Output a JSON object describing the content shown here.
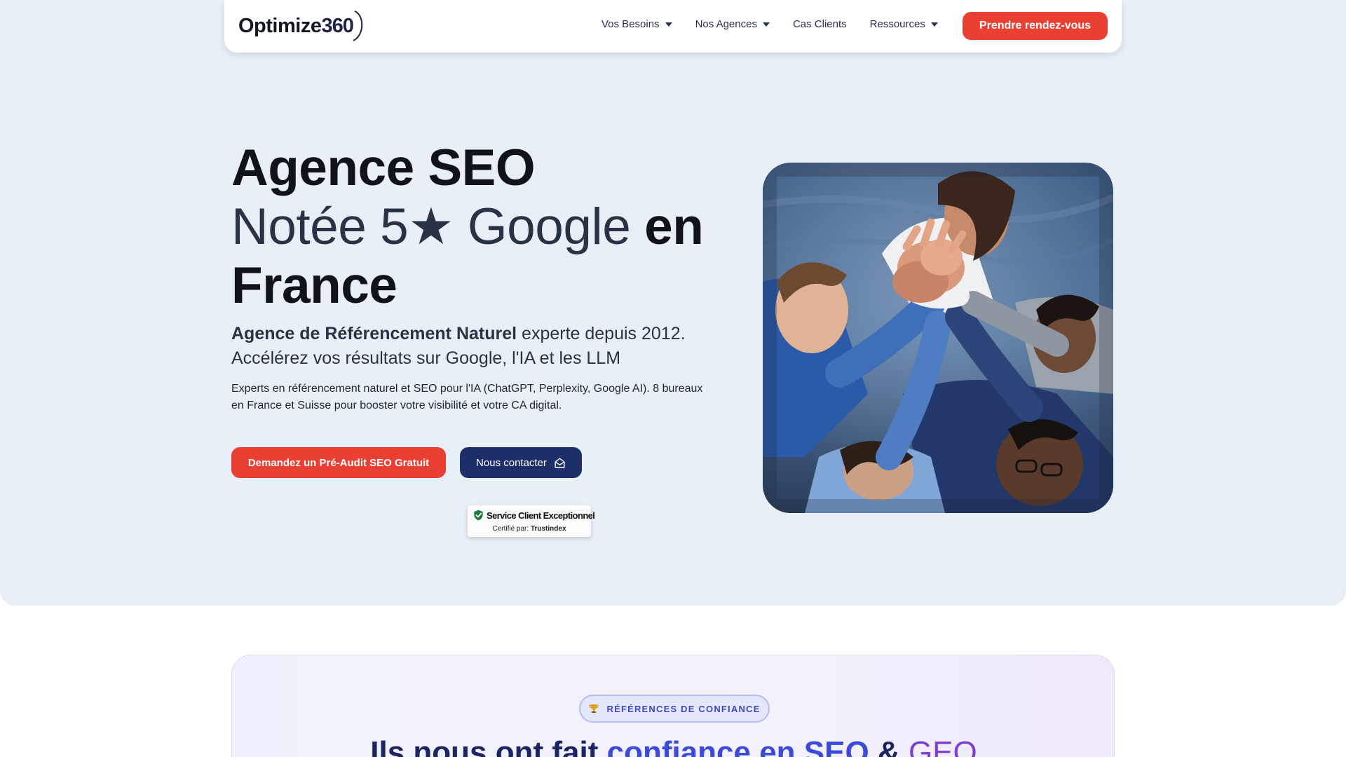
{
  "brand": {
    "logo_text": "Optimize",
    "logo_number": "360"
  },
  "nav": {
    "items": [
      {
        "label": "Vos Besoins",
        "dropdown": true
      },
      {
        "label": "Nos Agences",
        "dropdown": true
      },
      {
        "label": "Cas Clients",
        "dropdown": false
      },
      {
        "label": "Ressources",
        "dropdown": true
      }
    ],
    "cta_label": "Prendre rendez-vous"
  },
  "hero": {
    "title_line1": "Agence SEO",
    "title_rating": "Notée 5★ Google",
    "title_en": "en",
    "title_line3": "France",
    "subtitle_bold": "Agence de Référencement Naturel",
    "subtitle_rest": " experte depuis 2012.",
    "subtitle_line2": "Accélérez vos résultats sur Google, l'IA et les LLM",
    "description": "Experts en référencement naturel et SEO pour l'IA (ChatGPT, Perplexity, Google AI). 8 bureaux en France et Suisse pour booster votre visibilité et votre CA digital.",
    "btn_audit": "Demandez un Pré-Audit SEO Gratuit",
    "btn_contact": "Nous contacter"
  },
  "trust_badge": {
    "title": "Service Client Exceptionnel",
    "certified_label": "Certifié par:",
    "certifier": "Trustindex"
  },
  "references": {
    "pill_label": "RÉFÉRENCES DE CONFIANCE",
    "heading_start": "Ils nous ont fait ",
    "heading_accent": "confiance en SEO",
    "heading_amp": " & ",
    "heading_geo": "GEO"
  },
  "colors": {
    "accent_red": "#ea3f33",
    "navy": "#1d2f6b",
    "hero_bg": "#e9eff7",
    "trust_green": "#1e7a3c"
  },
  "icons": [
    "chevron-down-icon",
    "envelope-open-icon",
    "shield-check-icon",
    "trophy-icon"
  ]
}
